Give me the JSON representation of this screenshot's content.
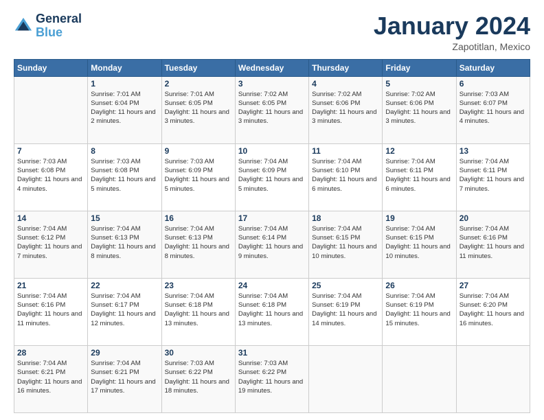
{
  "header": {
    "logo_line1": "General",
    "logo_line2": "Blue",
    "month_title": "January 2024",
    "location": "Zapotitlan, Mexico"
  },
  "days_of_week": [
    "Sunday",
    "Monday",
    "Tuesday",
    "Wednesday",
    "Thursday",
    "Friday",
    "Saturday"
  ],
  "weeks": [
    [
      {
        "day": "",
        "sunrise": "",
        "sunset": "",
        "daylight": ""
      },
      {
        "day": "1",
        "sunrise": "Sunrise: 7:01 AM",
        "sunset": "Sunset: 6:04 PM",
        "daylight": "Daylight: 11 hours and 2 minutes."
      },
      {
        "day": "2",
        "sunrise": "Sunrise: 7:01 AM",
        "sunset": "Sunset: 6:05 PM",
        "daylight": "Daylight: 11 hours and 3 minutes."
      },
      {
        "day": "3",
        "sunrise": "Sunrise: 7:02 AM",
        "sunset": "Sunset: 6:05 PM",
        "daylight": "Daylight: 11 hours and 3 minutes."
      },
      {
        "day": "4",
        "sunrise": "Sunrise: 7:02 AM",
        "sunset": "Sunset: 6:06 PM",
        "daylight": "Daylight: 11 hours and 3 minutes."
      },
      {
        "day": "5",
        "sunrise": "Sunrise: 7:02 AM",
        "sunset": "Sunset: 6:06 PM",
        "daylight": "Daylight: 11 hours and 3 minutes."
      },
      {
        "day": "6",
        "sunrise": "Sunrise: 7:03 AM",
        "sunset": "Sunset: 6:07 PM",
        "daylight": "Daylight: 11 hours and 4 minutes."
      }
    ],
    [
      {
        "day": "7",
        "sunrise": "Sunrise: 7:03 AM",
        "sunset": "Sunset: 6:08 PM",
        "daylight": "Daylight: 11 hours and 4 minutes."
      },
      {
        "day": "8",
        "sunrise": "Sunrise: 7:03 AM",
        "sunset": "Sunset: 6:08 PM",
        "daylight": "Daylight: 11 hours and 5 minutes."
      },
      {
        "day": "9",
        "sunrise": "Sunrise: 7:03 AM",
        "sunset": "Sunset: 6:09 PM",
        "daylight": "Daylight: 11 hours and 5 minutes."
      },
      {
        "day": "10",
        "sunrise": "Sunrise: 7:04 AM",
        "sunset": "Sunset: 6:09 PM",
        "daylight": "Daylight: 11 hours and 5 minutes."
      },
      {
        "day": "11",
        "sunrise": "Sunrise: 7:04 AM",
        "sunset": "Sunset: 6:10 PM",
        "daylight": "Daylight: 11 hours and 6 minutes."
      },
      {
        "day": "12",
        "sunrise": "Sunrise: 7:04 AM",
        "sunset": "Sunset: 6:11 PM",
        "daylight": "Daylight: 11 hours and 6 minutes."
      },
      {
        "day": "13",
        "sunrise": "Sunrise: 7:04 AM",
        "sunset": "Sunset: 6:11 PM",
        "daylight": "Daylight: 11 hours and 7 minutes."
      }
    ],
    [
      {
        "day": "14",
        "sunrise": "Sunrise: 7:04 AM",
        "sunset": "Sunset: 6:12 PM",
        "daylight": "Daylight: 11 hours and 7 minutes."
      },
      {
        "day": "15",
        "sunrise": "Sunrise: 7:04 AM",
        "sunset": "Sunset: 6:13 PM",
        "daylight": "Daylight: 11 hours and 8 minutes."
      },
      {
        "day": "16",
        "sunrise": "Sunrise: 7:04 AM",
        "sunset": "Sunset: 6:13 PM",
        "daylight": "Daylight: 11 hours and 8 minutes."
      },
      {
        "day": "17",
        "sunrise": "Sunrise: 7:04 AM",
        "sunset": "Sunset: 6:14 PM",
        "daylight": "Daylight: 11 hours and 9 minutes."
      },
      {
        "day": "18",
        "sunrise": "Sunrise: 7:04 AM",
        "sunset": "Sunset: 6:15 PM",
        "daylight": "Daylight: 11 hours and 10 minutes."
      },
      {
        "day": "19",
        "sunrise": "Sunrise: 7:04 AM",
        "sunset": "Sunset: 6:15 PM",
        "daylight": "Daylight: 11 hours and 10 minutes."
      },
      {
        "day": "20",
        "sunrise": "Sunrise: 7:04 AM",
        "sunset": "Sunset: 6:16 PM",
        "daylight": "Daylight: 11 hours and 11 minutes."
      }
    ],
    [
      {
        "day": "21",
        "sunrise": "Sunrise: 7:04 AM",
        "sunset": "Sunset: 6:16 PM",
        "daylight": "Daylight: 11 hours and 11 minutes."
      },
      {
        "day": "22",
        "sunrise": "Sunrise: 7:04 AM",
        "sunset": "Sunset: 6:17 PM",
        "daylight": "Daylight: 11 hours and 12 minutes."
      },
      {
        "day": "23",
        "sunrise": "Sunrise: 7:04 AM",
        "sunset": "Sunset: 6:18 PM",
        "daylight": "Daylight: 11 hours and 13 minutes."
      },
      {
        "day": "24",
        "sunrise": "Sunrise: 7:04 AM",
        "sunset": "Sunset: 6:18 PM",
        "daylight": "Daylight: 11 hours and 13 minutes."
      },
      {
        "day": "25",
        "sunrise": "Sunrise: 7:04 AM",
        "sunset": "Sunset: 6:19 PM",
        "daylight": "Daylight: 11 hours and 14 minutes."
      },
      {
        "day": "26",
        "sunrise": "Sunrise: 7:04 AM",
        "sunset": "Sunset: 6:19 PM",
        "daylight": "Daylight: 11 hours and 15 minutes."
      },
      {
        "day": "27",
        "sunrise": "Sunrise: 7:04 AM",
        "sunset": "Sunset: 6:20 PM",
        "daylight": "Daylight: 11 hours and 16 minutes."
      }
    ],
    [
      {
        "day": "28",
        "sunrise": "Sunrise: 7:04 AM",
        "sunset": "Sunset: 6:21 PM",
        "daylight": "Daylight: 11 hours and 16 minutes."
      },
      {
        "day": "29",
        "sunrise": "Sunrise: 7:04 AM",
        "sunset": "Sunset: 6:21 PM",
        "daylight": "Daylight: 11 hours and 17 minutes."
      },
      {
        "day": "30",
        "sunrise": "Sunrise: 7:03 AM",
        "sunset": "Sunset: 6:22 PM",
        "daylight": "Daylight: 11 hours and 18 minutes."
      },
      {
        "day": "31",
        "sunrise": "Sunrise: 7:03 AM",
        "sunset": "Sunset: 6:22 PM",
        "daylight": "Daylight: 11 hours and 19 minutes."
      },
      {
        "day": "",
        "sunrise": "",
        "sunset": "",
        "daylight": ""
      },
      {
        "day": "",
        "sunrise": "",
        "sunset": "",
        "daylight": ""
      },
      {
        "day": "",
        "sunrise": "",
        "sunset": "",
        "daylight": ""
      }
    ]
  ]
}
